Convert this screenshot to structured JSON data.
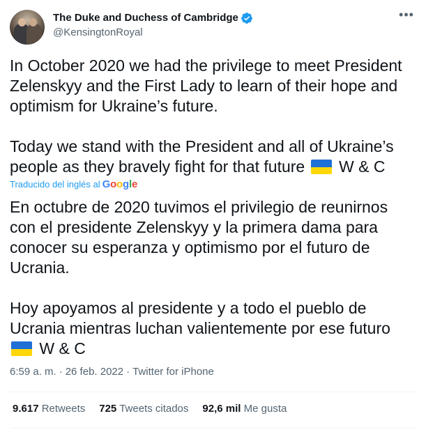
{
  "author": {
    "display_name": "The Duke and Duchess of Cambridge",
    "handle": "@KensingtonRoyal",
    "verified_color": "#1d9bf0"
  },
  "menu_icon": "more-horizontal-icon",
  "tweet": {
    "original_p1": "In October 2020 we had the privilege to meet President Zelenskyy and the First Lady to learn of their hope and optimism for Ukraine’s future.",
    "original_p2": "Today we stand with the President and all of Ukraine’s people as they bravely fight for that future",
    "original_p2_tail": "W & C",
    "translated_label": "Traducido del inglés al",
    "translation_provider": "Google",
    "translated_p1": "En octubre de 2020 tuvimos el privilegio de reunirnos con el presidente Zelenskyy y la primera dama para conocer su esperanza y optimismo por el futuro de Ucrania.",
    "translated_p2": " Hoy apoyamos al presidente y a todo el pueblo de Ucrania mientras luchan valientemente por ese futuro",
    "translated_p2_tail": "W & C"
  },
  "meta": {
    "time": "6:59 a. m.",
    "separator": "·",
    "date": "26 feb. 2022",
    "source": "Twitter for iPhone"
  },
  "stats": {
    "retweets_count": "9.617",
    "retweets_label": "Retweets",
    "quotes_count": "725",
    "quotes_label": "Tweets citados",
    "likes_count": "92,6 mil",
    "likes_label": "Me gusta"
  },
  "colors": {
    "link": "#1d9bf0",
    "muted": "#536471",
    "flag_blue": "#1e6fd6",
    "flag_yellow": "#ffd60a"
  }
}
